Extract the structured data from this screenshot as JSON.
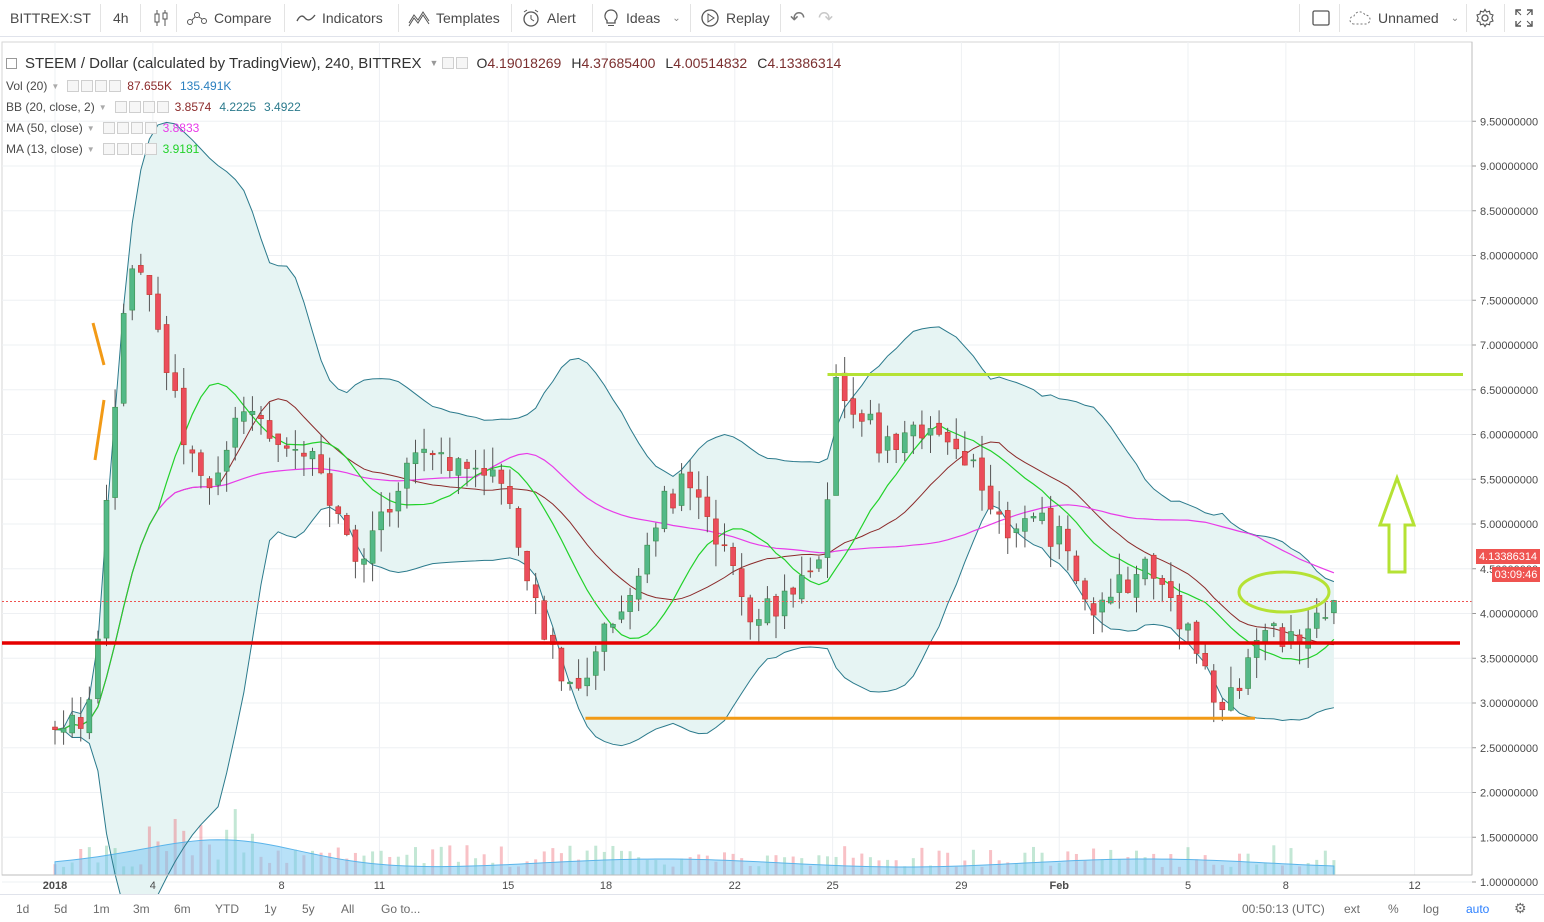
{
  "toolbar": {
    "symbol": "BITTREX:ST",
    "interval": "4h",
    "compare": "Compare",
    "indicators": "Indicators",
    "templates": "Templates",
    "alert": "Alert",
    "ideas": "Ideas",
    "replay": "Replay",
    "layout_name": "Unnamed"
  },
  "legend": {
    "title": "STEEM / Dollar (calculated by TradingView), 240, BITTREX",
    "o_label": "O",
    "o": "4.19018269",
    "h_label": "H",
    "h": "4.37685400",
    "l_label": "L",
    "l": "4.00514832",
    "c_label": "C",
    "c": "4.13386314",
    "vol_name": "Vol (20)",
    "vol_v1": "87.655K",
    "vol_v2": "135.491K",
    "bb_name": "BB (20, close, 2)",
    "bb_v1": "3.8574",
    "bb_v2": "4.2225",
    "bb_v3": "3.4922",
    "ma50_name": "MA (50, close)",
    "ma50_v": "3.8833",
    "ma13_name": "MA (13, close)",
    "ma13_v": "3.9181"
  },
  "price_tag": "4.13386314",
  "countdown_tag": "03:09:46",
  "bottombar": {
    "ranges": [
      "1d",
      "5d",
      "1m",
      "3m",
      "6m",
      "YTD",
      "1y",
      "5y",
      "All"
    ],
    "goto": "Go to...",
    "time": "00:50:13 (UTC)",
    "ext": "ext",
    "pct": "%",
    "log": "log",
    "auto": "auto"
  },
  "colors": {
    "up": "#53b987",
    "down": "#eb4d5c",
    "bb_line": "#2b7a8c",
    "bb_fill": "#e6f4f3",
    "ma50": "#e83be8",
    "ma13": "#22d22a",
    "mid": "#8b2a2a",
    "red_line": "#e50000",
    "orange_line": "#f29a16",
    "green_line": "#b5e234",
    "tag_red": "#ef5350"
  },
  "chart_data": {
    "type": "candlestick",
    "title": "STEEM / Dollar (calculated by TradingView), 240, BITTREX",
    "x_ticks": [
      "2018",
      "4",
      "8",
      "11",
      "15",
      "18",
      "22",
      "25",
      "29",
      "Feb",
      "5",
      "8",
      "12"
    ],
    "y_ticks": [
      "1.00000000",
      "1.50000000",
      "2.00000000",
      "2.50000000",
      "3.00000000",
      "3.50000000",
      "4.00000000",
      "4.50000000",
      "5.00000000",
      "5.50000000",
      "6.00000000",
      "6.50000000",
      "7.00000000",
      "7.50000000",
      "8.00000000",
      "8.50000000",
      "9.00000000",
      "9.50000000"
    ],
    "ylim": [
      0.6,
      10.0
    ],
    "last_close": 4.13386314,
    "close_path": [
      [
        0,
        2.65
      ],
      [
        0.2,
        2.7
      ],
      [
        0.4,
        2.75
      ],
      [
        0.55,
        2.85
      ],
      [
        0.7,
        3.0
      ],
      [
        0.8,
        3.3
      ],
      [
        0.9,
        4.2
      ],
      [
        1.0,
        5.2
      ],
      [
        1.1,
        6.0
      ],
      [
        1.2,
        6.5
      ],
      [
        1.3,
        7.0
      ],
      [
        1.4,
        7.6
      ],
      [
        1.55,
        8.1
      ],
      [
        1.7,
        7.9
      ],
      [
        1.85,
        7.4
      ],
      [
        2.0,
        7.1
      ],
      [
        2.15,
        6.8
      ],
      [
        2.35,
        6.3
      ],
      [
        2.55,
        5.9
      ],
      [
        2.8,
        5.5
      ],
      [
        3.0,
        5.3
      ],
      [
        3.2,
        5.6
      ],
      [
        3.4,
        5.9
      ],
      [
        3.6,
        6.3
      ],
      [
        3.8,
        6.4
      ],
      [
        4.0,
        6.1
      ],
      [
        4.2,
        5.9
      ],
      [
        4.45,
        6.0
      ],
      [
        4.7,
        5.9
      ],
      [
        5.0,
        5.7
      ],
      [
        5.3,
        5.3
      ],
      [
        5.6,
        4.8
      ],
      [
        5.9,
        4.5
      ],
      [
        6.2,
        4.9
      ],
      [
        6.5,
        5.3
      ],
      [
        6.8,
        5.6
      ],
      [
        7.1,
        5.8
      ],
      [
        7.4,
        5.9
      ],
      [
        7.7,
        5.7
      ],
      [
        8.0,
        5.6
      ],
      [
        8.3,
        5.7
      ],
      [
        8.6,
        5.5
      ],
      [
        8.9,
        5.0
      ],
      [
        9.2,
        4.3
      ],
      [
        9.5,
        3.8
      ],
      [
        9.8,
        3.4
      ],
      [
        10.0,
        3.1
      ],
      [
        10.2,
        3.2
      ],
      [
        10.4,
        3.5
      ],
      [
        10.7,
        3.8
      ],
      [
        11.0,
        4.1
      ],
      [
        11.3,
        4.5
      ],
      [
        11.6,
        5.0
      ],
      [
        11.9,
        5.3
      ],
      [
        12.2,
        5.4
      ],
      [
        12.5,
        5.2
      ],
      [
        12.8,
        4.8
      ],
      [
        13.1,
        4.5
      ],
      [
        13.4,
        4.1
      ],
      [
        13.7,
        4.0
      ],
      [
        14.0,
        4.1
      ],
      [
        14.3,
        4.2
      ],
      [
        14.6,
        4.3
      ],
      [
        14.9,
        4.5
      ],
      [
        15.0,
        5.2
      ],
      [
        15.1,
        6.2
      ],
      [
        15.2,
        6.6
      ],
      [
        15.5,
        6.4
      ],
      [
        15.8,
        6.1
      ],
      [
        16.1,
        5.9
      ],
      [
        16.4,
        6.0
      ],
      [
        16.7,
        6.1
      ],
      [
        17.0,
        6.0
      ],
      [
        17.3,
        5.9
      ],
      [
        17.6,
        5.7
      ],
      [
        17.9,
        5.5
      ],
      [
        18.2,
        5.2
      ],
      [
        18.5,
        5.0
      ],
      [
        18.8,
        4.9
      ],
      [
        19.1,
        5.0
      ],
      [
        19.4,
        4.9
      ],
      [
        19.7,
        4.7
      ],
      [
        19.9,
        4.4
      ],
      [
        20.1,
        3.8
      ],
      [
        20.3,
        4.0
      ],
      [
        20.6,
        4.3
      ],
      [
        20.9,
        4.4
      ],
      [
        21.2,
        4.5
      ],
      [
        21.5,
        4.3
      ],
      [
        21.8,
        4.0
      ],
      [
        22.1,
        3.7
      ],
      [
        22.3,
        3.3
      ],
      [
        22.5,
        3.0
      ],
      [
        22.7,
        2.8
      ],
      [
        22.9,
        3.1
      ],
      [
        23.1,
        3.5
      ],
      [
        23.3,
        3.7
      ],
      [
        23.6,
        3.8
      ],
      [
        23.9,
        3.75
      ],
      [
        24.2,
        3.8
      ],
      [
        24.5,
        3.9
      ],
      [
        24.8,
        4.05
      ],
      [
        25.0,
        4.13
      ]
    ],
    "levels": [
      {
        "name": "resistance",
        "value": 6.67,
        "x_from": 15.0,
        "x_to": 27.0
      },
      {
        "name": "support",
        "value": 3.67,
        "x_from": 0,
        "x_to": 26.9
      },
      {
        "name": "low",
        "value": 2.83,
        "x_from": 10.3,
        "x_to": 23.3
      }
    ],
    "volume_series": "Vol (20)",
    "overlays": [
      "BB (20, close, 2)",
      "MA (50, close)",
      "MA (13, close)"
    ],
    "grid": true,
    "annotations": [
      "green up arrow",
      "green ellipse around consolidation"
    ]
  }
}
